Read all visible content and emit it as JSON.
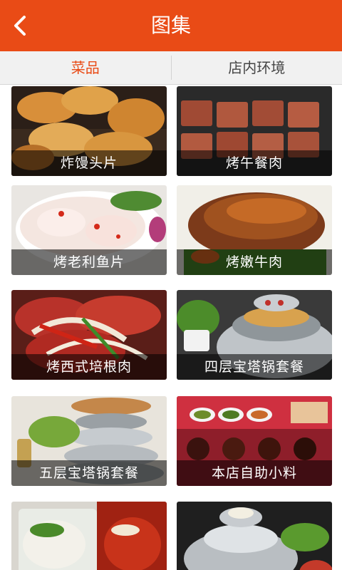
{
  "header": {
    "title": "图集",
    "back_icon": "chevron-left-icon"
  },
  "tabs": [
    {
      "label": "菜品",
      "active": true
    },
    {
      "label": "店内环境",
      "active": false
    }
  ],
  "gallery": [
    {
      "caption": "炸馒头片"
    },
    {
      "caption": "烤午餐肉"
    },
    {
      "caption": "烤老利鱼片"
    },
    {
      "caption": "烤嫩牛肉"
    },
    {
      "caption": "烤西式培根肉"
    },
    {
      "caption": "四层宝塔锅套餐"
    },
    {
      "caption": "五层宝塔锅套餐"
    },
    {
      "caption": "本店自助小料"
    },
    {
      "caption": ""
    },
    {
      "caption": ""
    }
  ],
  "colors": {
    "accent": "#e94b16",
    "tab_bg": "#f1f1f1"
  }
}
